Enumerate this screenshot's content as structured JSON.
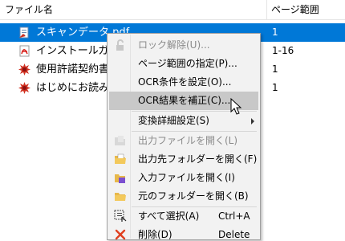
{
  "columns": {
    "name": "ファイル名",
    "pages": "ページ範囲"
  },
  "files": [
    {
      "name": "スキャンデータ.pdf",
      "pages": "1",
      "icon": "pdf-scan-icon",
      "selected": true
    },
    {
      "name": "インストールガイ",
      "pages": "1-16",
      "icon": "pdf-icon",
      "selected": false
    },
    {
      "name": "使用許諾契約書.j",
      "pages": "1",
      "icon": "image-file-icon",
      "selected": false
    },
    {
      "name": "はじめにお読みく",
      "pages": "1",
      "icon": "image-file-icon",
      "selected": false
    }
  ],
  "menu": {
    "unlock": "ロック解除(U)...",
    "page_range": "ページ範囲の指定(P)...",
    "ocr_settings": "OCR条件を設定(O)...",
    "ocr_correct": "OCR結果を補正(C)...",
    "convert_settings": "変換詳細設定(S)",
    "open_output_file": "出力ファイルを開く(L)",
    "open_output_folder": "出力先フォルダーを開く(F)",
    "open_input_file": "入力ファイルを開く(I)",
    "open_source_folder": "元のフォルダーを開く(B)",
    "select_all": "すべて選択(A)",
    "select_all_shortcut": "Ctrl+A",
    "delete": "削除(D)",
    "delete_shortcut": "Delete"
  },
  "colors": {
    "selection": "#0078d7",
    "menu_bg": "#f2f2f2",
    "menu_hover": "#c8c8c8",
    "disabled_text": "#8a8a8a"
  }
}
